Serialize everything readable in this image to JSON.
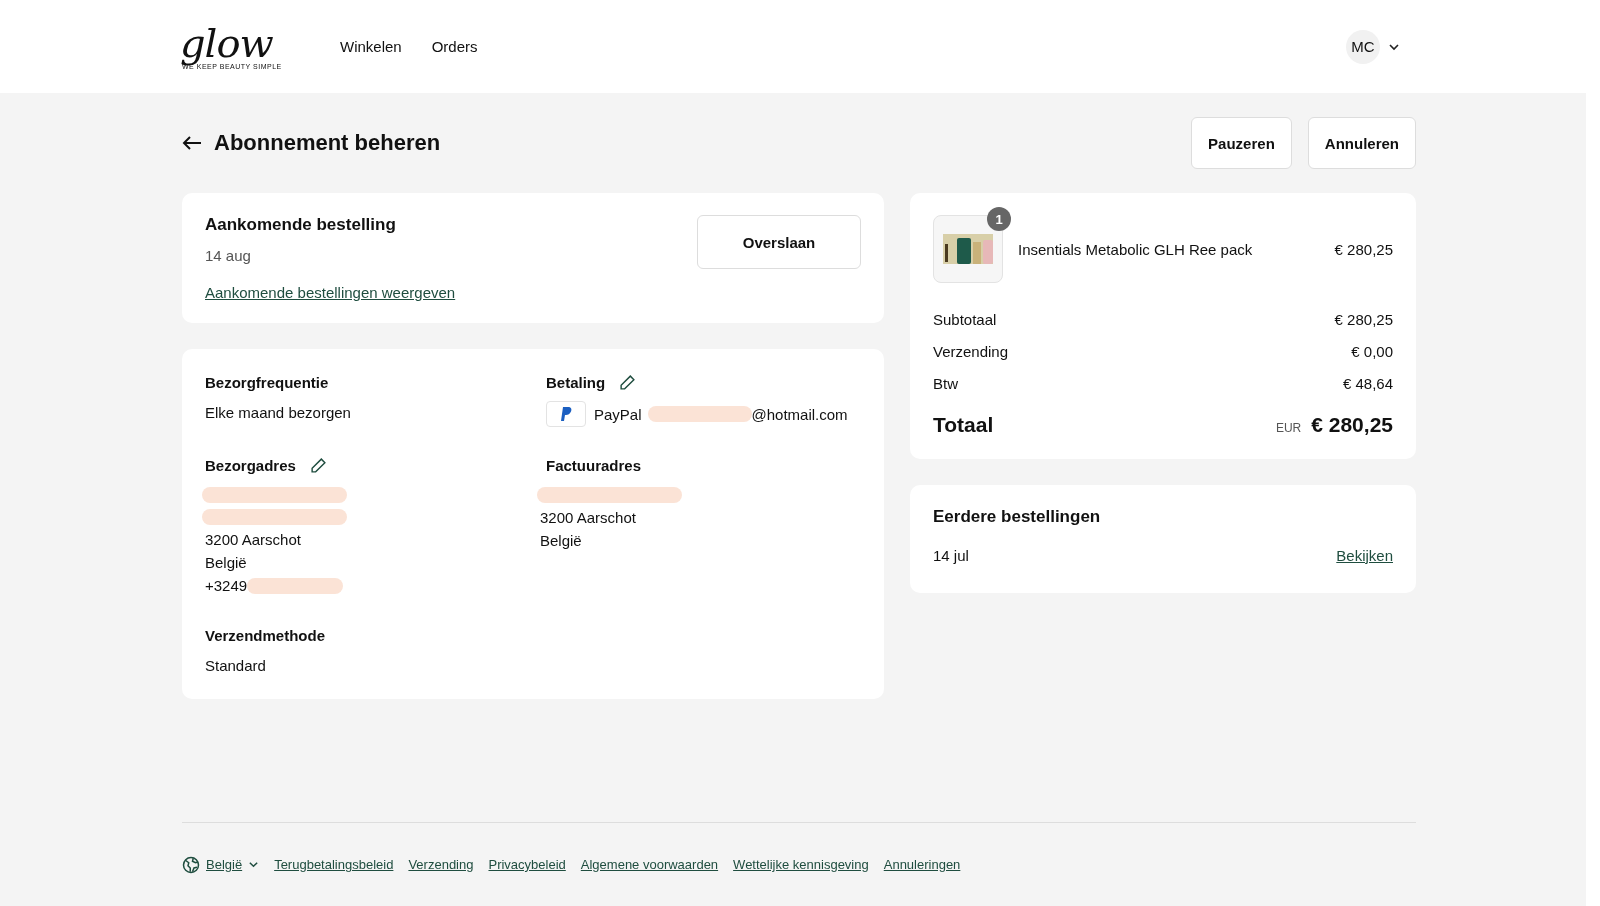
{
  "header": {
    "logo": {
      "wordmark": "glow",
      "tagline": "WE KEEP BEAUTY SIMPLE"
    },
    "nav": [
      "Winkelen",
      "Orders"
    ],
    "account": {
      "initials": "MC"
    }
  },
  "page": {
    "title": "Abonnement beheren",
    "actions": [
      "Pauzeren",
      "Annuleren"
    ]
  },
  "upcoming": {
    "title": "Aankomende bestelling",
    "date": "14 aug",
    "skip_button": "Overslaan",
    "link": "Aankomende bestellingen weergeven"
  },
  "details": {
    "frequency": {
      "label": "Bezorgfrequentie",
      "value": "Elke maand bezorgen"
    },
    "payment": {
      "label": "Betaling",
      "method": "PayPal",
      "email_suffix": "@hotmail.com"
    },
    "shipping_address": {
      "label": "Bezorgadres",
      "lines": [
        {
          "redacted": true
        },
        {
          "redacted": true
        },
        {
          "text": "3200 Aarschot",
          "redacted": false
        },
        {
          "text": "België",
          "redacted": false
        },
        {
          "text": "+3249",
          "redacted": true
        }
      ]
    },
    "billing_address": {
      "label": "Factuuradres",
      "lines": [
        {
          "redacted": true
        },
        {
          "text": "3200 Aarschot",
          "redacted": false
        },
        {
          "text": "België",
          "redacted": false
        }
      ]
    },
    "shipping_method": {
      "label": "Verzendmethode",
      "value": "Standard"
    }
  },
  "summary": {
    "item": {
      "quantity": "1",
      "name": "Insentials Metabolic GLH Ree pack",
      "price": "€ 280,25"
    },
    "lines": [
      {
        "label": "Subtotaal",
        "value": "€ 280,25"
      },
      {
        "label": "Verzending",
        "value": "€ 0,00"
      },
      {
        "label": "Btw",
        "value": "€ 48,64"
      }
    ],
    "total": {
      "label": "Totaal",
      "currency": "EUR",
      "value": "€ 280,25"
    }
  },
  "previous": {
    "title": "Eerdere bestellingen",
    "date": "14 jul",
    "link": "Bekijken"
  },
  "footer": {
    "country": "België",
    "links": [
      "Terugbetalingsbeleid",
      "Verzending",
      "Privacybeleid",
      "Algemene voorwaarden",
      "Wettelijke kennisgeving",
      "Annuleringen"
    ]
  }
}
